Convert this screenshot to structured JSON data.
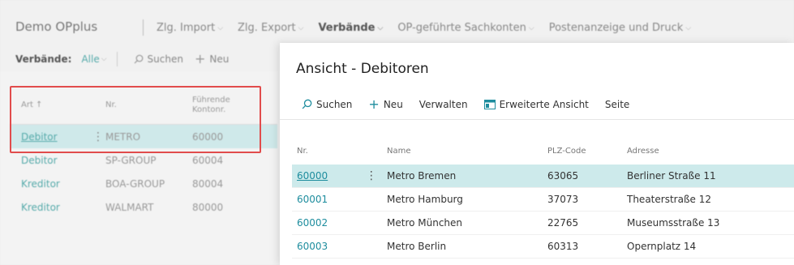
{
  "app": {
    "title": "Demo OPplus",
    "nav": [
      {
        "label": "Zlg. Import",
        "bold": false
      },
      {
        "label": "Zlg. Export",
        "bold": false
      },
      {
        "label": "Verbände",
        "bold": true
      },
      {
        "label": "OP-geführte Sachkonten",
        "bold": false
      },
      {
        "label": "Postenanzeige und Druck",
        "bold": false
      }
    ]
  },
  "page": {
    "list_label": "Verbände:",
    "filter_value": "Alle",
    "search_label": "Suchen",
    "new_label": "Neu",
    "columns": {
      "art": "Art ↑",
      "nr": "Nr.",
      "fuehrende": "Führende Kontonr."
    },
    "rows": [
      {
        "art": "Debitor",
        "nr": "METRO",
        "kontonr": "60000"
      },
      {
        "art": "Debitor",
        "nr": "SP-GROUP",
        "kontonr": "60004"
      },
      {
        "art": "Kreditor",
        "nr": "BOA-GROUP",
        "kontonr": "80004"
      },
      {
        "art": "Kreditor",
        "nr": "WALMART",
        "kontonr": "80000"
      }
    ]
  },
  "dialog": {
    "title": "Ansicht - Debitoren",
    "actions": {
      "search": "Suchen",
      "new": "Neu",
      "manage": "Verwalten",
      "extended_view": "Erweiterte Ansicht",
      "page": "Seite"
    },
    "columns": {
      "nr": "Nr.",
      "name": "Name",
      "plz": "PLZ-Code",
      "adresse": "Adresse"
    },
    "rows": [
      {
        "nr": "60000",
        "name": "Metro Bremen",
        "plz": "63065",
        "adresse": "Berliner Straße 11"
      },
      {
        "nr": "60001",
        "name": "Metro Hamburg",
        "plz": "37073",
        "adresse": "Theaterstraße 12"
      },
      {
        "nr": "60002",
        "name": "Metro München",
        "plz": "22765",
        "adresse": "Museumsstraße 13"
      },
      {
        "nr": "60003",
        "name": "Metro Berlin",
        "plz": "60313",
        "adresse": "Opernplatz 14"
      }
    ]
  },
  "colors": {
    "accent": "#1e8d9e",
    "highlight": "#cdeaeb",
    "callout": "#e14c4c"
  },
  "icons": [
    "search-icon",
    "plus-icon",
    "extended-view-icon",
    "chevron-down-icon",
    "more-dots-icon"
  ]
}
